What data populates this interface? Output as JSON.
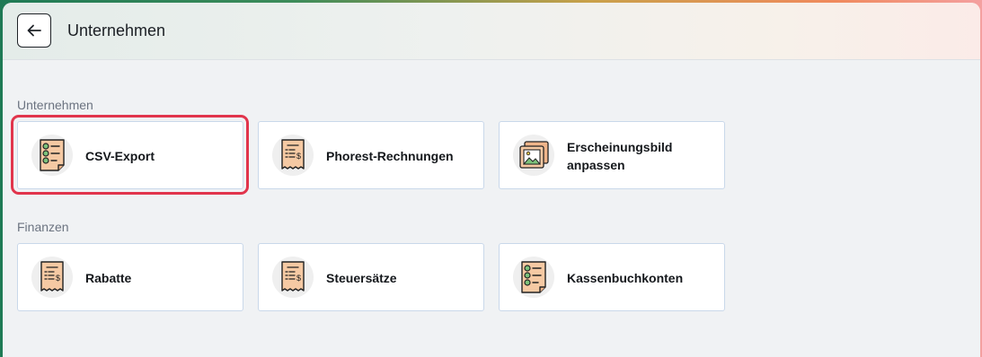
{
  "header": {
    "title": "Unternehmen",
    "back_icon": "arrow-left-icon"
  },
  "sections": [
    {
      "label": "Unternehmen",
      "cards": [
        {
          "label": "CSV-Export",
          "icon": "checklist-icon",
          "highlighted": true
        },
        {
          "label": "Phorest-Rechnungen",
          "icon": "receipt-icon"
        },
        {
          "label": "Erscheinungsbild anpassen",
          "icon": "picture-icon"
        }
      ]
    },
    {
      "label": "Finanzen",
      "cards": [
        {
          "label": "Rabatte",
          "icon": "receipt-icon"
        },
        {
          "label": "Steuersätze",
          "icon": "receipt-icon"
        },
        {
          "label": "Kassenbuchkonten",
          "icon": "checklist-icon"
        }
      ]
    }
  ],
  "colors": {
    "highlight": "#e1354c",
    "card_border": "#c9d8ea",
    "icon_fill": "#f5c9a3"
  }
}
